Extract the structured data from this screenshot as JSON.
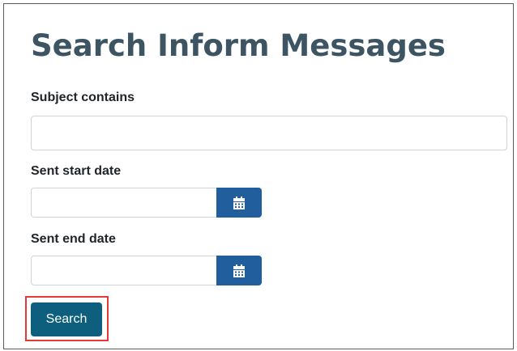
{
  "page": {
    "title": "Search Inform Messages"
  },
  "form": {
    "subject": {
      "label": "Subject contains",
      "value": "",
      "placeholder": ""
    },
    "start_date": {
      "label": "Sent start date",
      "value": "",
      "placeholder": "",
      "icon": "calendar-icon"
    },
    "end_date": {
      "label": "Sent end date",
      "value": "",
      "placeholder": "",
      "icon": "calendar-icon"
    },
    "search_label": "Search"
  },
  "colors": {
    "title": "#3d5563",
    "calendar_button": "#215e9e",
    "search_button": "#0e5f7e",
    "highlight": "#e5383b"
  }
}
